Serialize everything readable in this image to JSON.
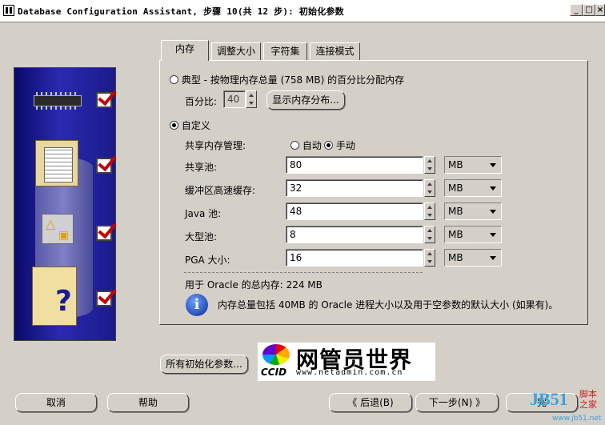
{
  "window": {
    "title": "Database Configuration Assistant, 步骤 10(共 12 步): 初始化参数",
    "min": "_",
    "max": "□",
    "close": "×"
  },
  "tabs": [
    {
      "label": "内存",
      "active": true
    },
    {
      "label": "调整大小",
      "active": false
    },
    {
      "label": "字符集",
      "active": false
    },
    {
      "label": "连接模式",
      "active": false
    }
  ],
  "memory": {
    "typical_label": "典型 - 按物理内存总量 (758 MB) 的百分比分配内存",
    "percent_label": "百分比:",
    "percent_value": "40",
    "show_dist_button": "显示内存分布...",
    "custom_label": "自定义",
    "shared_mgmt_label": "共享内存管理:",
    "auto_label": "自动",
    "manual_label": "手动",
    "rows": [
      {
        "label": "共享池:",
        "value": "80",
        "unit": "MB"
      },
      {
        "label": "缓冲区高速缓存:",
        "value": "32",
        "unit": "MB"
      },
      {
        "label": "Java 池:",
        "value": "48",
        "unit": "MB"
      },
      {
        "label": "大型池:",
        "value": "8",
        "unit": "MB"
      },
      {
        "label": "PGA 大小:",
        "value": "16",
        "unit": "MB"
      }
    ],
    "total_label": "用于 Oracle 的总内存:",
    "total_value": "224 MB",
    "info_text": "内存总量包括 40MB 的 Oracle 进程大小以及用于空参数的默认大小 (如果有)。"
  },
  "buttons": {
    "all_params": "所有初始化参数...",
    "cancel": "取消",
    "help": "帮助",
    "back": "《  后退(B)",
    "next": "下一步(N)  》",
    "finish": "完"
  },
  "watermark": {
    "ccid": "CCID",
    "brand": "网管员世界",
    "url": "www.netadmin.com.cn",
    "jb51": "JB51",
    "jb51_cn": "脚本之家",
    "jb51_url": "www.jb51.net"
  },
  "colors": {
    "face": "#d4d0c8",
    "art_blue": "#2a2ab0",
    "check_red": "#cc0000",
    "info_blue": "#0a2a9a"
  }
}
